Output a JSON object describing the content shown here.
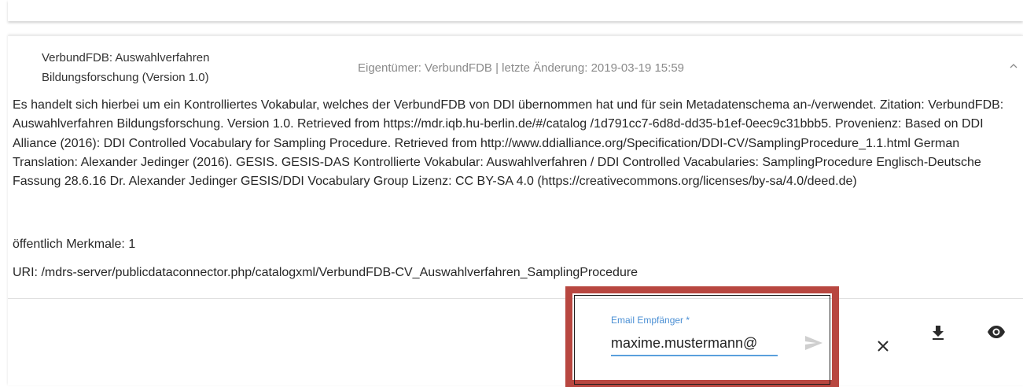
{
  "entry": {
    "title": "VerbundFDB: Auswahlverfahren Bildungsforschung (Version 1.0)",
    "meta": "Eigentümer: VerbundFDB | letzte Änderung: 2019-03-19 15:59",
    "description": "Es handelt sich hierbei um ein Kontrolliertes Vokabular, welches der VerbundFDB von DDI übernommen hat und für sein Metadatenschema an-/verwendet. Zitation: VerbundFDB: Auswahlverfahren Bildungsforschung. Version 1.0. Retrieved from https://mdr.iqb.hu-berlin.de/#/catalog /1d791cc7-6d8d-dd35-b1ef-0eec9c31bbb5. Provenienz: Based on DDI Alliance (2016): DDI Controlled Vocabulary for Sampling Procedure. Retrieved from http://www.ddialliance.org/Specification/DDI-CV/SamplingProcedure_1.1.html German Translation: Alexander Jedinger (2016). GESIS. GESIS-DAS Kontrollierte Vokabular: Auswahlverfahren / DDI Controlled Vacabularies: SamplingProcedure Englisch-Deutsche Fassung 28.6.16 Dr. Alexander Jedinger GESIS/DDI Vocabulary Group Lizenz: CC BY-SA 4.0 (https://creativecommons.org/licenses/by-sa/4.0/deed.de)",
    "public_features": "öffentlich Merkmale: 1",
    "uri": "URI: /mdrs-server/publicdataconnector.php/catalogxml/VerbundFDB-CV_Auswahlverfahren_SamplingProcedure"
  },
  "email": {
    "label": "Email Empfänger *",
    "value": "maxime.mustermann@"
  },
  "icons": {
    "collapse": "chevron-up-icon",
    "send": "send-icon",
    "close": "close-icon",
    "download": "download-icon",
    "view": "eye-icon"
  },
  "colors": {
    "accent": "#4a8fd4",
    "highlight": "#b84740"
  }
}
